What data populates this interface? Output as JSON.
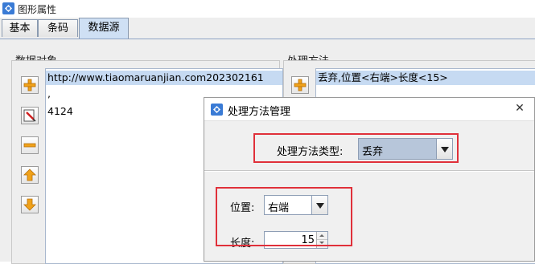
{
  "window": {
    "title": "图形属性"
  },
  "tabs": [
    {
      "label": "基本",
      "active": false
    },
    {
      "label": "条码",
      "active": false
    },
    {
      "label": "数据源",
      "active": true
    }
  ],
  "data_objects": {
    "label": "数据对象",
    "items": [
      "http://www.tiaomaruanjian.com202302161",
      ",",
      "4124"
    ]
  },
  "methods": {
    "label": "处理方法",
    "items": [
      "丢弃,位置<右端>长度<15>"
    ]
  },
  "dialog": {
    "title": "处理方法管理",
    "type_label": "处理方法类型:",
    "type_value": "丢弃",
    "position_label": "位置:",
    "position_value": "右端",
    "length_label": "长度:",
    "length_value": "15"
  },
  "colors": {
    "highlight_box": "#e0303a",
    "selection": "#c6daf2"
  }
}
